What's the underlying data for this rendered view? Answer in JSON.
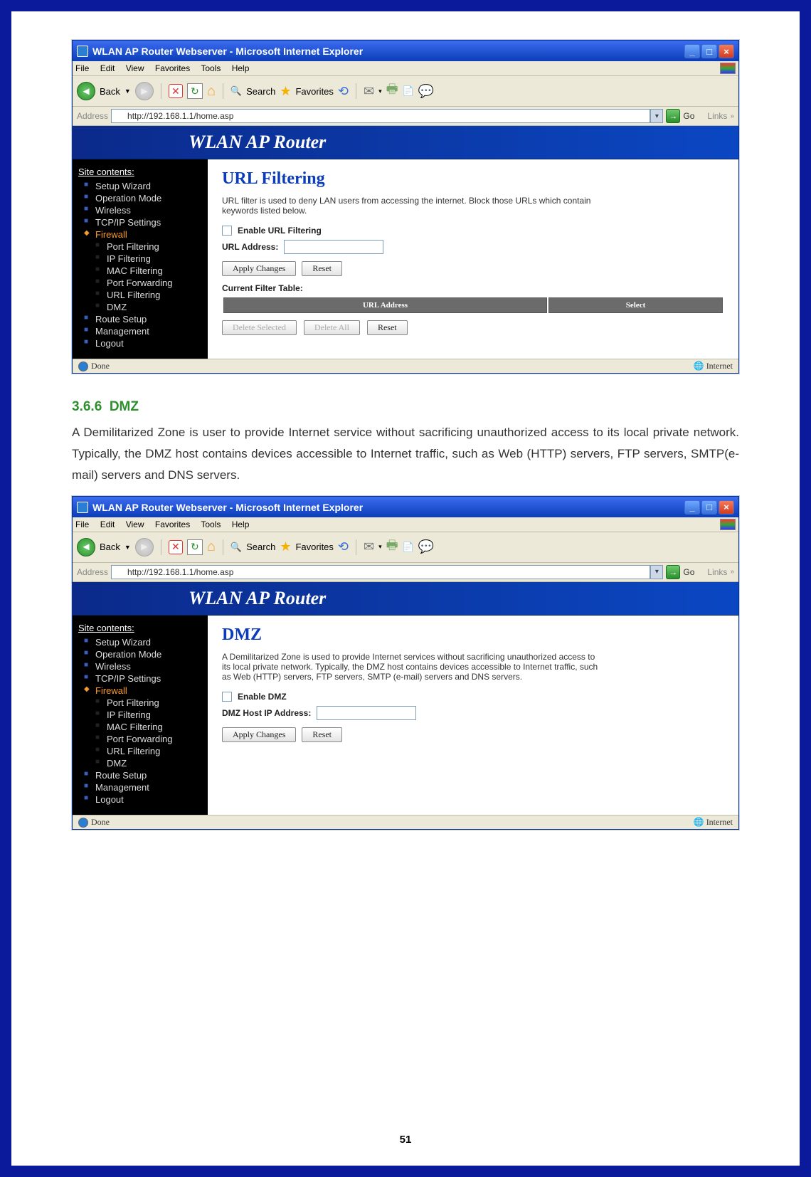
{
  "ie": {
    "title_url": "WLAN AP Router Webserver - Microsoft Internet Explorer",
    "title_dmz": "WLAN AP Router Webserver - Microsoft Internet Explorer",
    "menu": {
      "file": "File",
      "edit": "Edit",
      "view": "View",
      "favorites": "Favorites",
      "tools": "Tools",
      "help": "Help"
    },
    "toolbar": {
      "back": "Back",
      "search": "Search",
      "favorites": "Favorites"
    },
    "address_label": "Address",
    "address_url": "http://192.168.1.1/home.asp",
    "go": "Go",
    "links": "Links",
    "status_done": "Done",
    "status_zone": "Internet"
  },
  "router": {
    "banner": "WLAN AP Router",
    "sidebar": {
      "header": "Site contents:",
      "items": [
        "Setup Wizard",
        "Operation Mode",
        "Wireless",
        "TCP/IP Settings"
      ],
      "firewall": "Firewall",
      "sub": [
        "Port Filtering",
        "IP Filtering",
        "MAC Filtering",
        "Port Forwarding",
        "URL Filtering",
        "DMZ"
      ],
      "rest": [
        "Route Setup",
        "Management",
        "Logout"
      ]
    }
  },
  "url_page": {
    "title": "URL Filtering",
    "desc": "URL filter is used to deny LAN users from accessing the internet. Block those URLs which contain keywords listed below.",
    "enable": "Enable URL Filtering",
    "addr_label": "URL Address:",
    "apply": "Apply Changes",
    "reset": "Reset",
    "table_title": "Current Filter Table:",
    "th1": "URL Address",
    "th2": "Select",
    "del_sel": "Delete Selected",
    "del_all": "Delete All",
    "reset2": "Reset"
  },
  "section": {
    "num": "3.6.6",
    "name": "DMZ",
    "text": "A Demilitarized Zone is user to provide Internet service without sacrificing unauthorized access to its local private network. Typically, the DMZ host contains devices accessible to Internet traffic, such as Web (HTTP) servers, FTP servers, SMTP(e-mail) servers and DNS servers."
  },
  "dmz_page": {
    "title": "DMZ",
    "desc": "A Demilitarized Zone is used to provide Internet services without sacrificing unauthorized access to its local private network. Typically, the DMZ host contains devices accessible to Internet traffic, such as Web (HTTP) servers, FTP servers, SMTP (e-mail) servers and DNS servers.",
    "enable": "Enable DMZ",
    "host_label": "DMZ Host IP Address:",
    "apply": "Apply Changes",
    "reset": "Reset"
  },
  "page_number": "51"
}
